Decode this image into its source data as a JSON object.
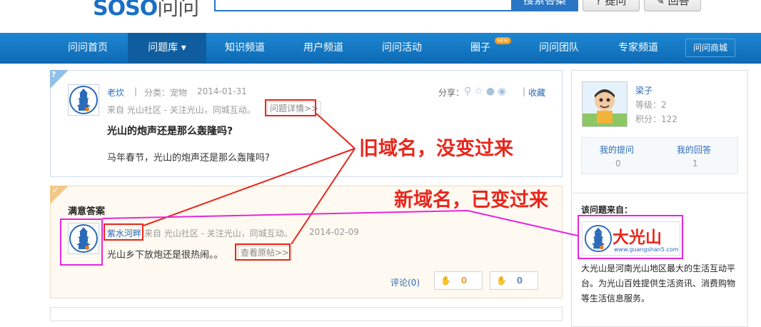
{
  "header": {
    "logo_brand": "SOSO",
    "logo_product": "问问",
    "search_placeholder": "",
    "search_button": "搜索答案",
    "ask_button": "? 提问",
    "answer_button": "✎ 回答"
  },
  "nav": {
    "items": [
      {
        "label": "问问首页"
      },
      {
        "label": "问题库 ▾"
      },
      {
        "label": "知识频道"
      },
      {
        "label": "用户频道"
      },
      {
        "label": "问问活动"
      },
      {
        "label": "圈子"
      },
      {
        "label": "问问团队"
      },
      {
        "label": "专家频道"
      }
    ],
    "new_badge": "NEW",
    "mall_label": "问问商城"
  },
  "question": {
    "corner_mark": "?",
    "user": "老炊",
    "separator": "|",
    "category": "分类：宠物",
    "date": "2014-01-31",
    "share_label": "分享：",
    "favorite": "收藏",
    "source": "来自 光山社区 - 关注光山，同城互动。",
    "detail_link": "问题详情>>",
    "title": "光山的炮声还是那么轰隆吗?",
    "body": "马年春节，光山的炮声还是那么轰隆吗?"
  },
  "answer": {
    "corner_mark": "✓",
    "heading": "满意答案",
    "user": "紫水河畔",
    "source": "来自 光山社区 - 关注光山，同城互动。",
    "date": "2014-02-09",
    "text": "光山乡下放炮还是很热闹。。",
    "original_link": "查看原帖>>",
    "comments": "评论(0)",
    "upvotes": "0",
    "downvotes": "0"
  },
  "sidebar": {
    "username": "梁子",
    "level": "等级：2",
    "points": "积分：122",
    "my_questions_label": "我的提问",
    "my_questions_count": "0",
    "my_answers_label": "我的回答",
    "my_answers_count": "1",
    "source_heading": "该问题来自：",
    "source_logo_text": "大光山",
    "source_logo_url": "www.guangshan5.com",
    "source_desc": "大光山是河南光山地区最大的生活互动平台。为光山百姓提供生活资讯、消费购物等生活信息服务。"
  },
  "annotations": {
    "old_domain": "旧域名，没变过来",
    "new_domain": "新域名，已变过来"
  },
  "colors": {
    "nav_blue": "#1478c4",
    "annotation_red": "#e8261c",
    "annotation_magenta": "#e626e0",
    "link_blue": "#2a6ab8"
  }
}
